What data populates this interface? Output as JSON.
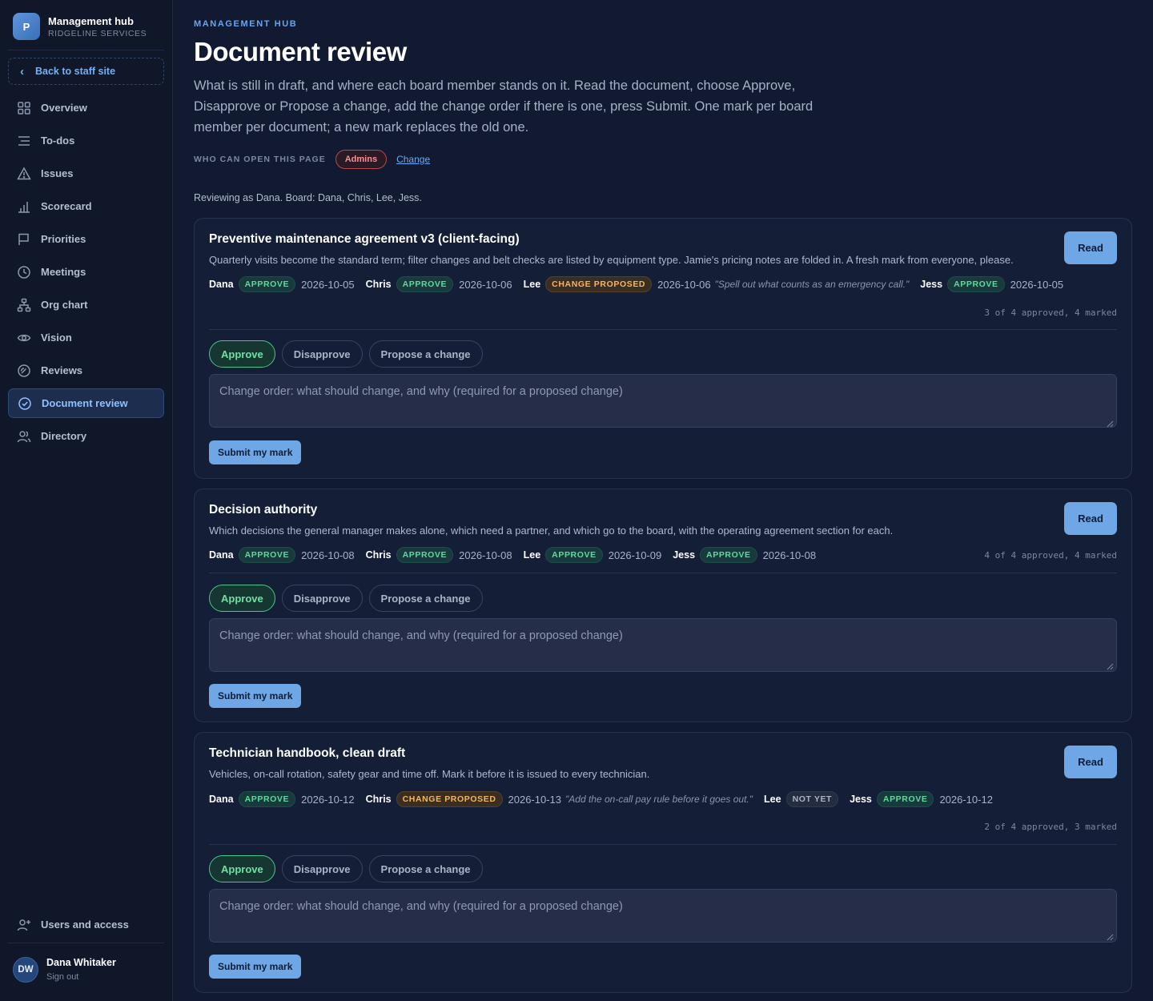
{
  "brand": {
    "logo": "P",
    "name": "Management hub",
    "subtitle": "RIDGELINE SERVICES"
  },
  "sidebar": {
    "back_label": "Back to staff site",
    "items": [
      {
        "label": "Overview",
        "icon": "grid-icon"
      },
      {
        "label": "To-dos",
        "icon": "list-icon"
      },
      {
        "label": "Issues",
        "icon": "warning-icon"
      },
      {
        "label": "Scorecard",
        "icon": "bar-chart-icon"
      },
      {
        "label": "Priorities",
        "icon": "flag-icon"
      },
      {
        "label": "Meetings",
        "icon": "clock-icon"
      },
      {
        "label": "Org chart",
        "icon": "org-chart-icon"
      },
      {
        "label": "Vision",
        "icon": "eye-icon"
      },
      {
        "label": "Reviews",
        "icon": "gauge-icon"
      },
      {
        "label": "Document review",
        "icon": "check-circle-icon",
        "active": true
      },
      {
        "label": "Directory",
        "icon": "people-icon"
      }
    ],
    "users_access": "Users and access",
    "user": {
      "initials": "DW",
      "name": "Dana Whitaker",
      "sign_out": "Sign out"
    }
  },
  "header": {
    "eyebrow": "MANAGEMENT HUB",
    "title": "Document review",
    "intro": "What is still in draft, and where each board member stands on it. Read the document, choose Approve, Disapprove or Propose a change, add the change order if there is one, press Submit. One mark per board member per document; a new mark replaces the old one.",
    "access_label": "WHO CAN OPEN THIS PAGE",
    "access_badge": "Admins",
    "change_link": "Change",
    "reviewing": "Reviewing as Dana. Board: Dana, Chris, Lee, Jess."
  },
  "controls": {
    "read": "Read",
    "choices": [
      "Approve",
      "Disapprove",
      "Propose a change"
    ],
    "placeholder": "Change order: what should change, and why (required for a proposed change)",
    "submit": "Submit my mark"
  },
  "documents": [
    {
      "title": "Preventive maintenance agreement v3 (client-facing)",
      "description": "Quarterly visits become the standard term; filter changes and belt checks are listed by equipment type. Jamie's pricing notes are folded in. A fresh mark from everyone, please.",
      "marks": [
        {
          "name": "Dana",
          "status": "APPROVE",
          "date": "2026-10-05",
          "note": ""
        },
        {
          "name": "Chris",
          "status": "APPROVE",
          "date": "2026-10-06",
          "note": ""
        },
        {
          "name": "Lee",
          "status": "CHANGE PROPOSED",
          "date": "2026-10-06",
          "note": "\"Spell out what counts as an emergency call.\""
        },
        {
          "name": "Jess",
          "status": "APPROVE",
          "date": "2026-10-05",
          "note": ""
        }
      ],
      "tally": "3 of 4 approved, 4 marked",
      "selected": "Approve"
    },
    {
      "title": "Decision authority",
      "description": "Which decisions the general manager makes alone, which need a partner, and which go to the board, with the operating agreement section for each.",
      "marks": [
        {
          "name": "Dana",
          "status": "APPROVE",
          "date": "2026-10-08",
          "note": ""
        },
        {
          "name": "Chris",
          "status": "APPROVE",
          "date": "2026-10-08",
          "note": ""
        },
        {
          "name": "Lee",
          "status": "APPROVE",
          "date": "2026-10-09",
          "note": ""
        },
        {
          "name": "Jess",
          "status": "APPROVE",
          "date": "2026-10-08",
          "note": ""
        }
      ],
      "tally": "4 of 4 approved, 4 marked",
      "selected": "Approve"
    },
    {
      "title": "Technician handbook, clean draft",
      "description": "Vehicles, on-call rotation, safety gear and time off. Mark it before it is issued to every technician.",
      "marks": [
        {
          "name": "Dana",
          "status": "APPROVE",
          "date": "2026-10-12",
          "note": ""
        },
        {
          "name": "Chris",
          "status": "CHANGE PROPOSED",
          "date": "2026-10-13",
          "note": "\"Add the on-call pay rule before it goes out.\""
        },
        {
          "name": "Lee",
          "status": "NOT YET",
          "date": "",
          "note": ""
        },
        {
          "name": "Jess",
          "status": "APPROVE",
          "date": "2026-10-12",
          "note": ""
        }
      ],
      "tally": "2 of 4 approved, 3 marked",
      "selected": "Approve"
    }
  ],
  "colors": {
    "accent": "#6fa6e6",
    "approve": "#63d79d",
    "change_proposed": "#f4b65e",
    "admins": "#ff8f8f",
    "background": "#111a30"
  }
}
